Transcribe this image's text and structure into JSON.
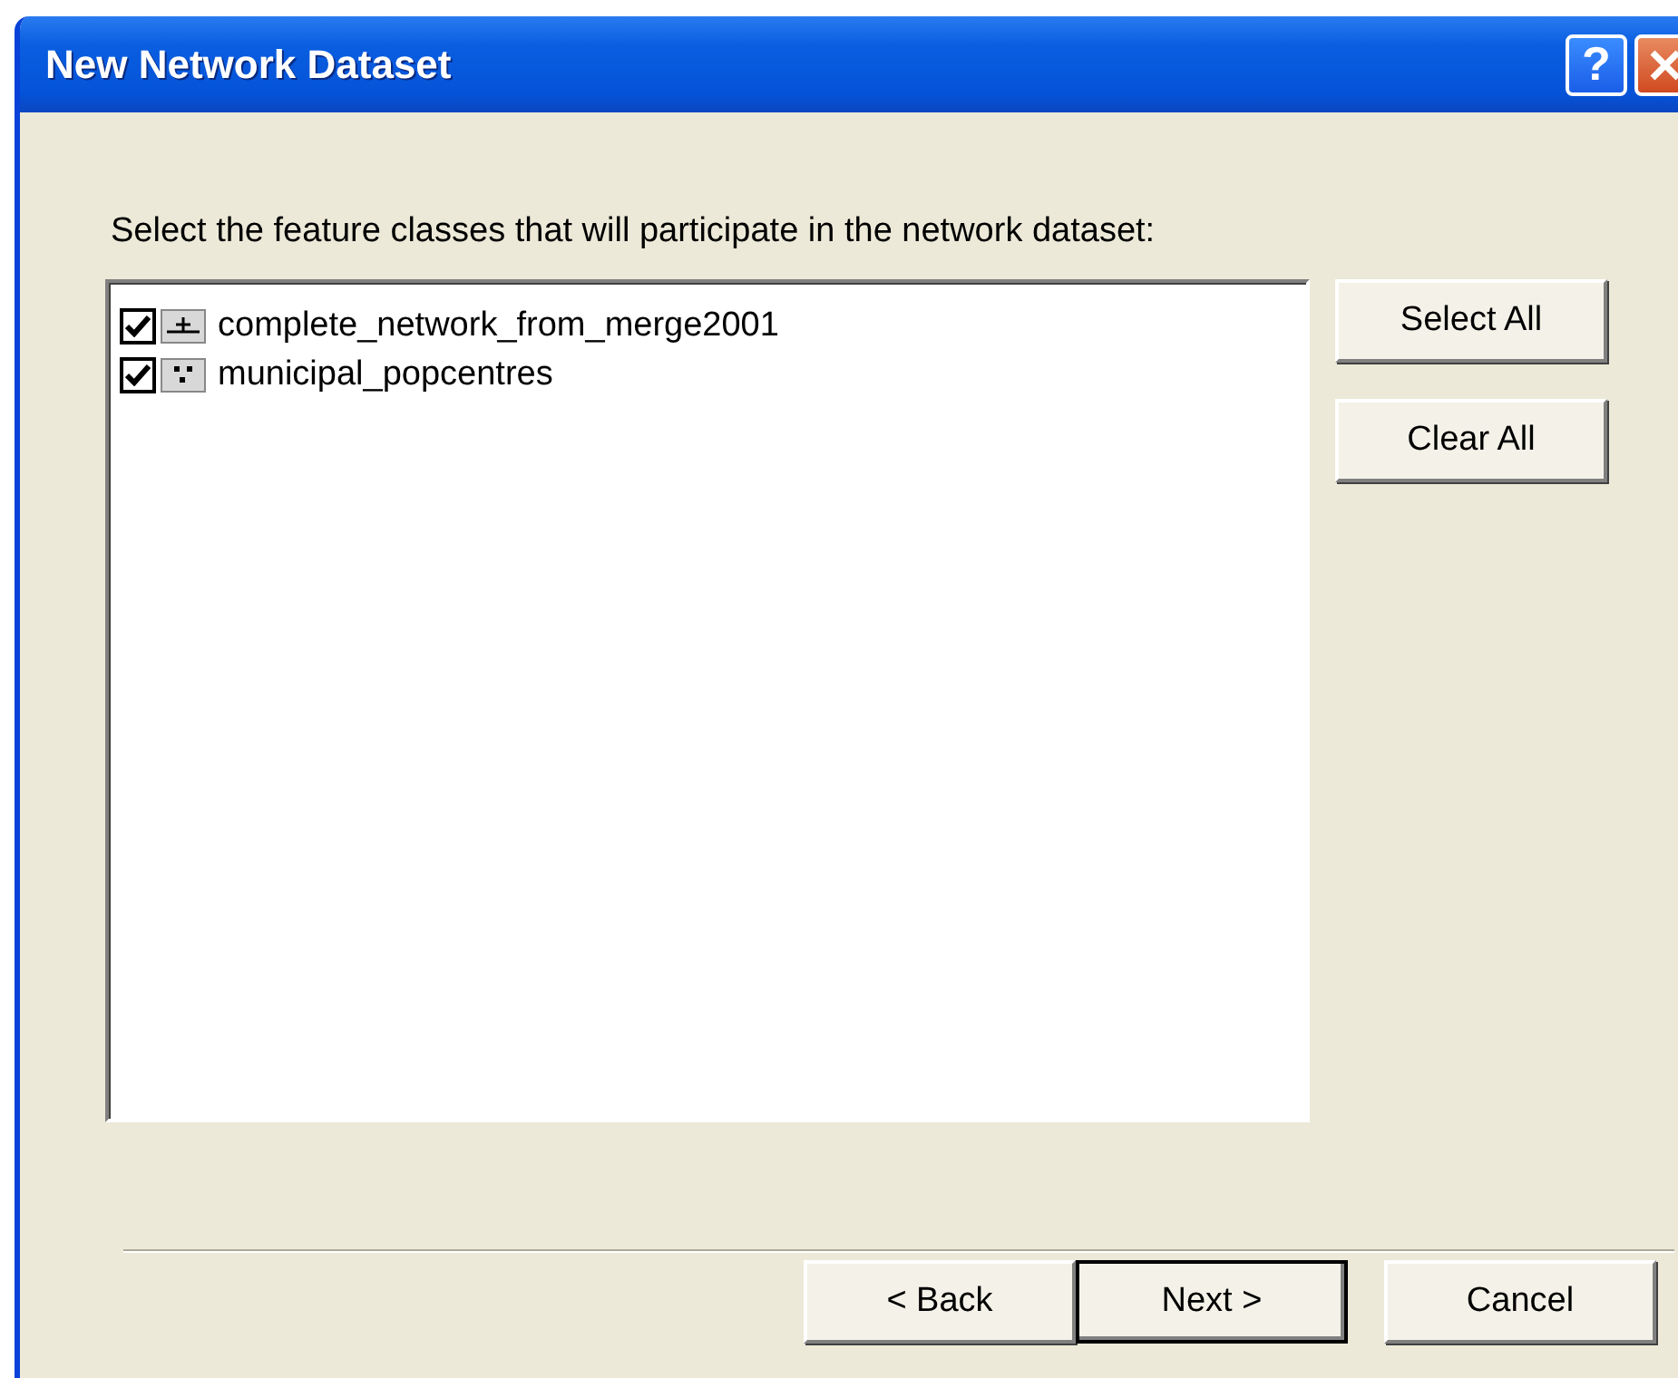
{
  "window": {
    "title": "New Network Dataset"
  },
  "title_buttons": [
    {
      "kind": "help",
      "label": "?"
    },
    {
      "kind": "close"
    }
  ],
  "instruction": "Select the feature classes that will participate in the network dataset:",
  "feature_classes": [
    {
      "name": "complete_network_from_merge2001",
      "kind": "line",
      "checked": true
    },
    {
      "name": "municipal_popcentres",
      "kind": "point",
      "checked": true
    }
  ],
  "side_buttons": [
    "Select All",
    "Clear All"
  ],
  "footer_buttons": [
    {
      "label": "< Back",
      "default": false
    },
    {
      "label": "Next >",
      "default": true
    },
    {
      "label": "Cancel",
      "default": false
    }
  ]
}
